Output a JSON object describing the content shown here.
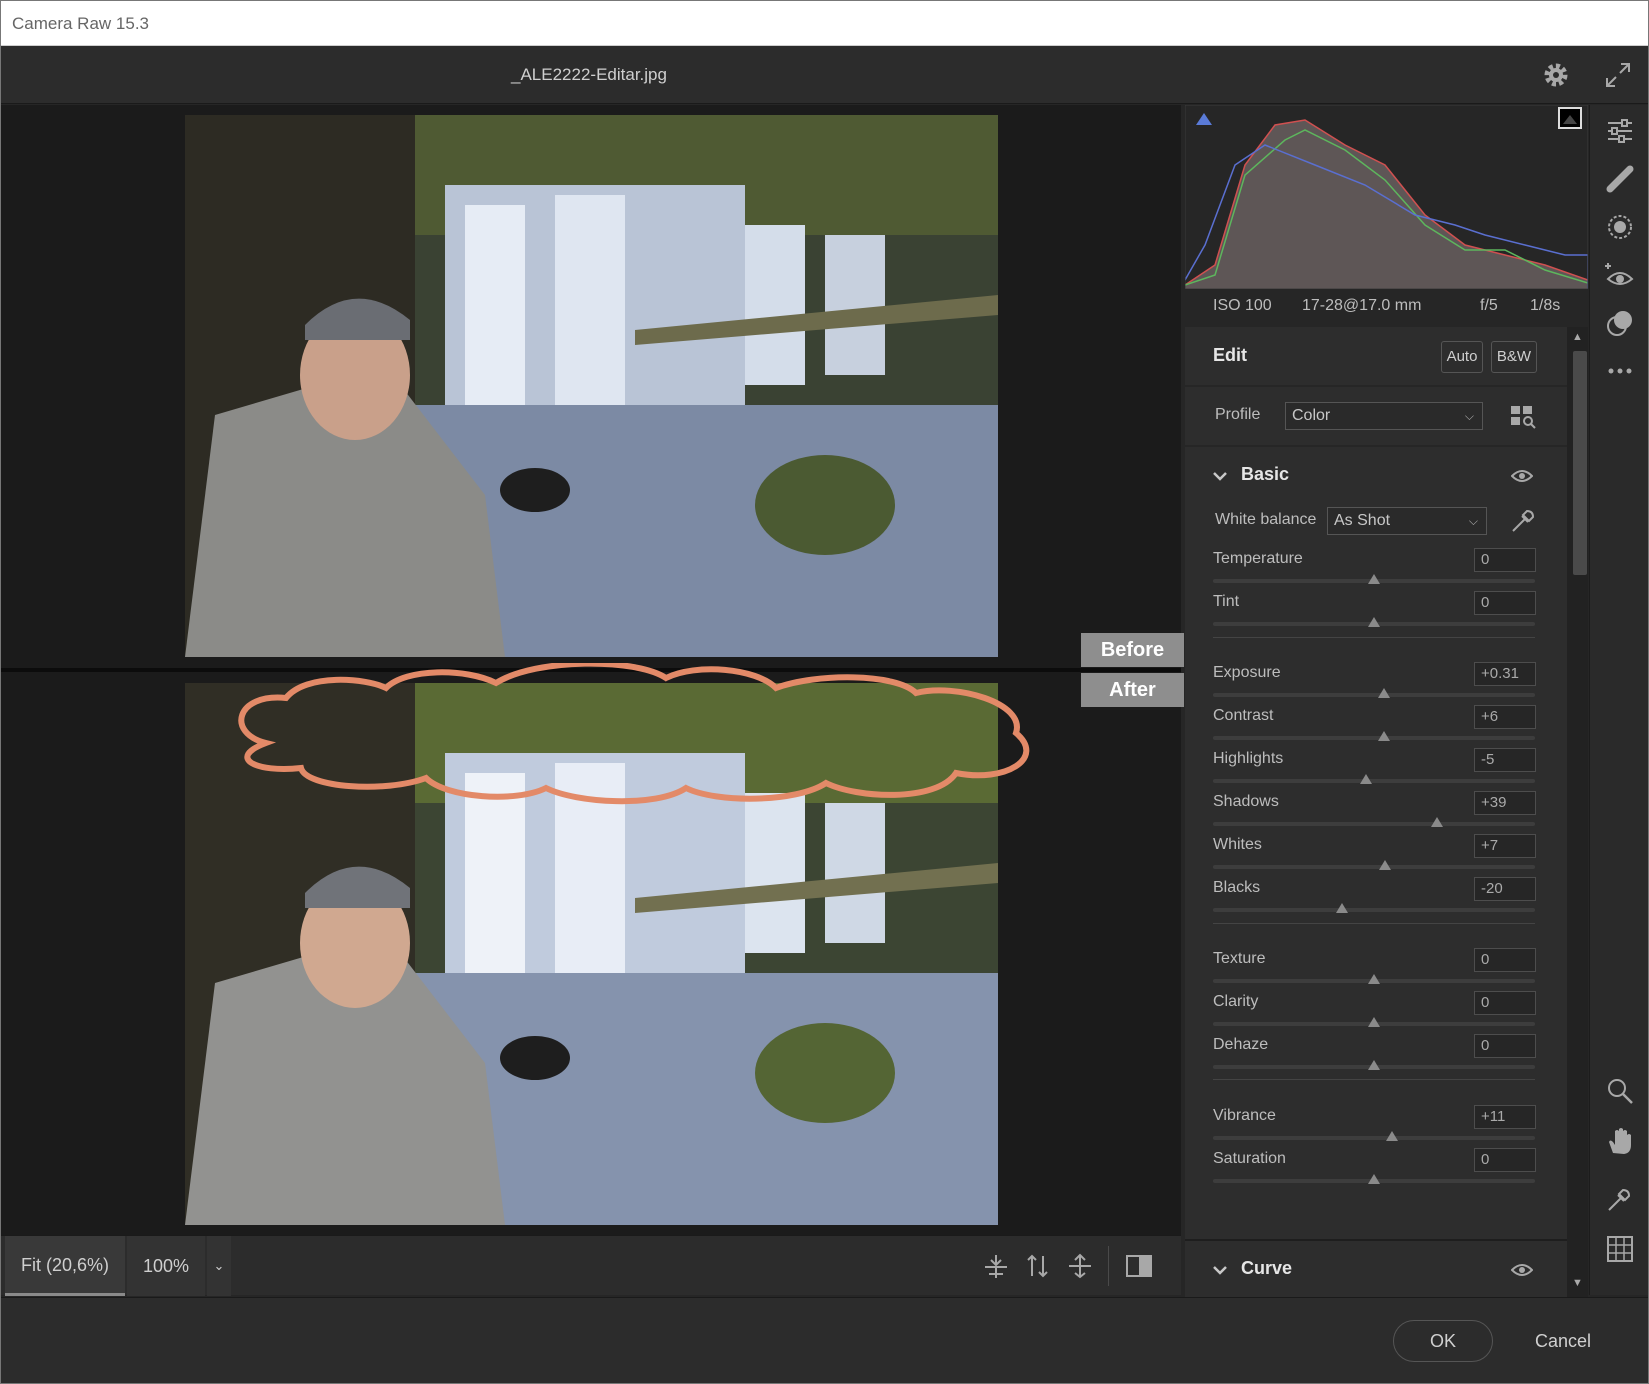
{
  "window": {
    "title": "Camera Raw 15.3"
  },
  "topbar": {
    "filename": "_ALE2222-Editar.jpg",
    "settings_icon": "gear-icon",
    "fullscreen_icon": "expand-icon"
  },
  "viewer": {
    "before_label": "Before",
    "after_label": "After",
    "annotation": "salmon-cloud-outline"
  },
  "viewer_bottom": {
    "fit_label": "Fit (20,6%)",
    "zoom_label": "100%",
    "zoom_dropdown": "⌄",
    "icons": [
      "swap-before-after-icon",
      "copy-settings-icon",
      "swap-settings-icon",
      "toggle-view-icon"
    ]
  },
  "histogram": {
    "shadow_clip_icon": "shadow-clipping-icon",
    "highlight_clip_icon": "highlight-clipping-icon"
  },
  "exif": {
    "iso": "ISO 100",
    "lens": "17-28@17.0 mm",
    "aperture": "f/5",
    "shutter": "1/8s"
  },
  "edit": {
    "title": "Edit",
    "auto_label": "Auto",
    "bw_label": "B&W",
    "profile_label": "Profile",
    "profile_value": "Color",
    "profile_browser_icon": "grid-search-icon"
  },
  "basic": {
    "title": "Basic",
    "white_balance_label": "White balance",
    "white_balance_value": "As Shot",
    "eyedropper_icon": "eyedropper-icon",
    "sliders": [
      {
        "label": "Temperature",
        "value": "0",
        "pos": 0.5
      },
      {
        "label": "Tint",
        "value": "0",
        "pos": 0.5
      },
      {
        "label": "Exposure",
        "value": "+0.31",
        "pos": 0.53
      },
      {
        "label": "Contrast",
        "value": "+6",
        "pos": 0.53
      },
      {
        "label": "Highlights",
        "value": "-5",
        "pos": 0.475
      },
      {
        "label": "Shadows",
        "value": "+39",
        "pos": 0.695
      },
      {
        "label": "Whites",
        "value": "+7",
        "pos": 0.535
      },
      {
        "label": "Blacks",
        "value": "-20",
        "pos": 0.4
      },
      {
        "label": "Texture",
        "value": "0",
        "pos": 0.5
      },
      {
        "label": "Clarity",
        "value": "0",
        "pos": 0.5
      },
      {
        "label": "Dehaze",
        "value": "0",
        "pos": 0.5
      },
      {
        "label": "Vibrance",
        "value": "+11",
        "pos": 0.555
      },
      {
        "label": "Saturation",
        "value": "0",
        "pos": 0.5
      }
    ]
  },
  "curve": {
    "title": "Curve"
  },
  "footer": {
    "ok_label": "OK",
    "cancel_label": "Cancel"
  },
  "tools": [
    "edit-sliders-icon",
    "healing-icon",
    "mask-icon",
    "red-eye-icon",
    "presets-icon",
    "more-icon",
    "zoom-icon",
    "hand-icon",
    "sampler-icon",
    "grid-icon"
  ],
  "colors": {
    "accent_cloud": "#e38a68",
    "panel_bg": "#2d2d2d",
    "app_bg": "#262626"
  }
}
